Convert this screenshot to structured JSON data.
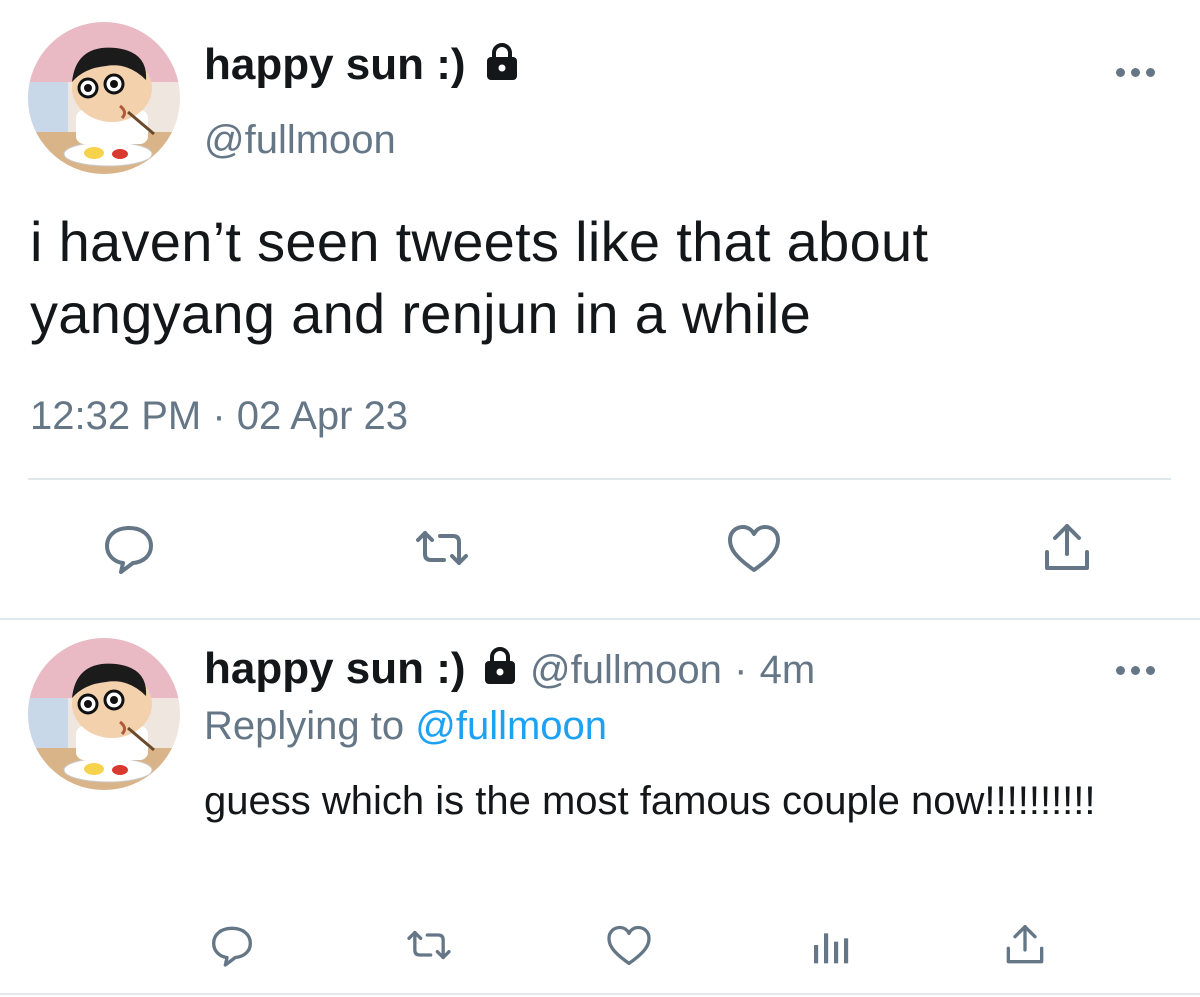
{
  "tweet": {
    "author_name": "happy sun :)",
    "author_handle": "@fullmoon",
    "text": "i haven’t seen tweets like that about yangyang and renjun in a while",
    "time": "12:32 PM",
    "separator": "·",
    "date": "02 Apr 23",
    "icons": [
      "lock-icon",
      "more-icon",
      "reply-icon",
      "retweet-icon",
      "like-icon",
      "share-icon"
    ]
  },
  "reply": {
    "author_name": "happy sun :)",
    "author_handle": "@fullmoon",
    "separator": "·",
    "age": "4m",
    "replying_prefix": "Replying to",
    "replying_to": "@fullmoon",
    "text": "guess which is the most famous couple now!!!!!!!!!!",
    "icons": [
      "lock-icon",
      "more-icon",
      "reply-icon",
      "retweet-icon",
      "like-icon",
      "analytics-icon",
      "share-icon"
    ]
  },
  "colors": {
    "text": "#14171a",
    "secondary": "#657786",
    "link": "#1da1f2",
    "divider": "#e1e8ed"
  }
}
